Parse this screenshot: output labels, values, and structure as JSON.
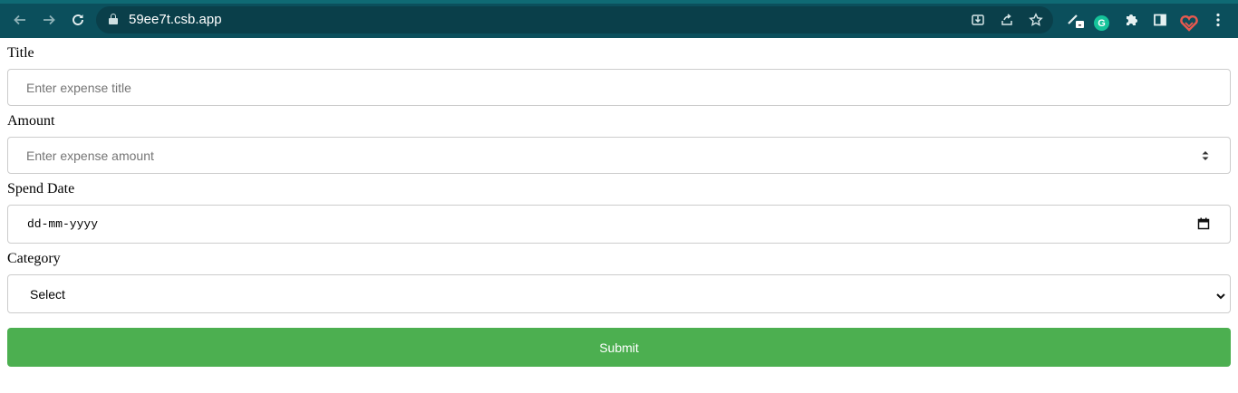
{
  "browser": {
    "url": "59ee7t.csb.app",
    "icons": [
      "back-icon",
      "forward-icon",
      "reload-icon",
      "lock-icon",
      "install-icon",
      "share-icon",
      "bookmark-star-icon",
      "pen-extension-icon",
      "grammarly-icon",
      "extensions-puzzle-icon",
      "side-panel-icon",
      "heart-extension-icon",
      "menu-kebab-icon"
    ],
    "grammarly_letter": "G",
    "colors": {
      "toolbar": "#0b4f5c",
      "omnibox": "#0a3f4a"
    }
  },
  "form": {
    "title": {
      "label": "Title",
      "placeholder": "Enter expense title"
    },
    "amount": {
      "label": "Amount",
      "placeholder": "Enter expense amount"
    },
    "spend_date": {
      "label": "Spend Date",
      "value": "dd-mm-yyyy"
    },
    "category": {
      "label": "Category",
      "selected": "Select"
    },
    "submit_label": "Submit",
    "colors": {
      "submit_bg": "#4caf50",
      "border": "#cccccc"
    }
  }
}
